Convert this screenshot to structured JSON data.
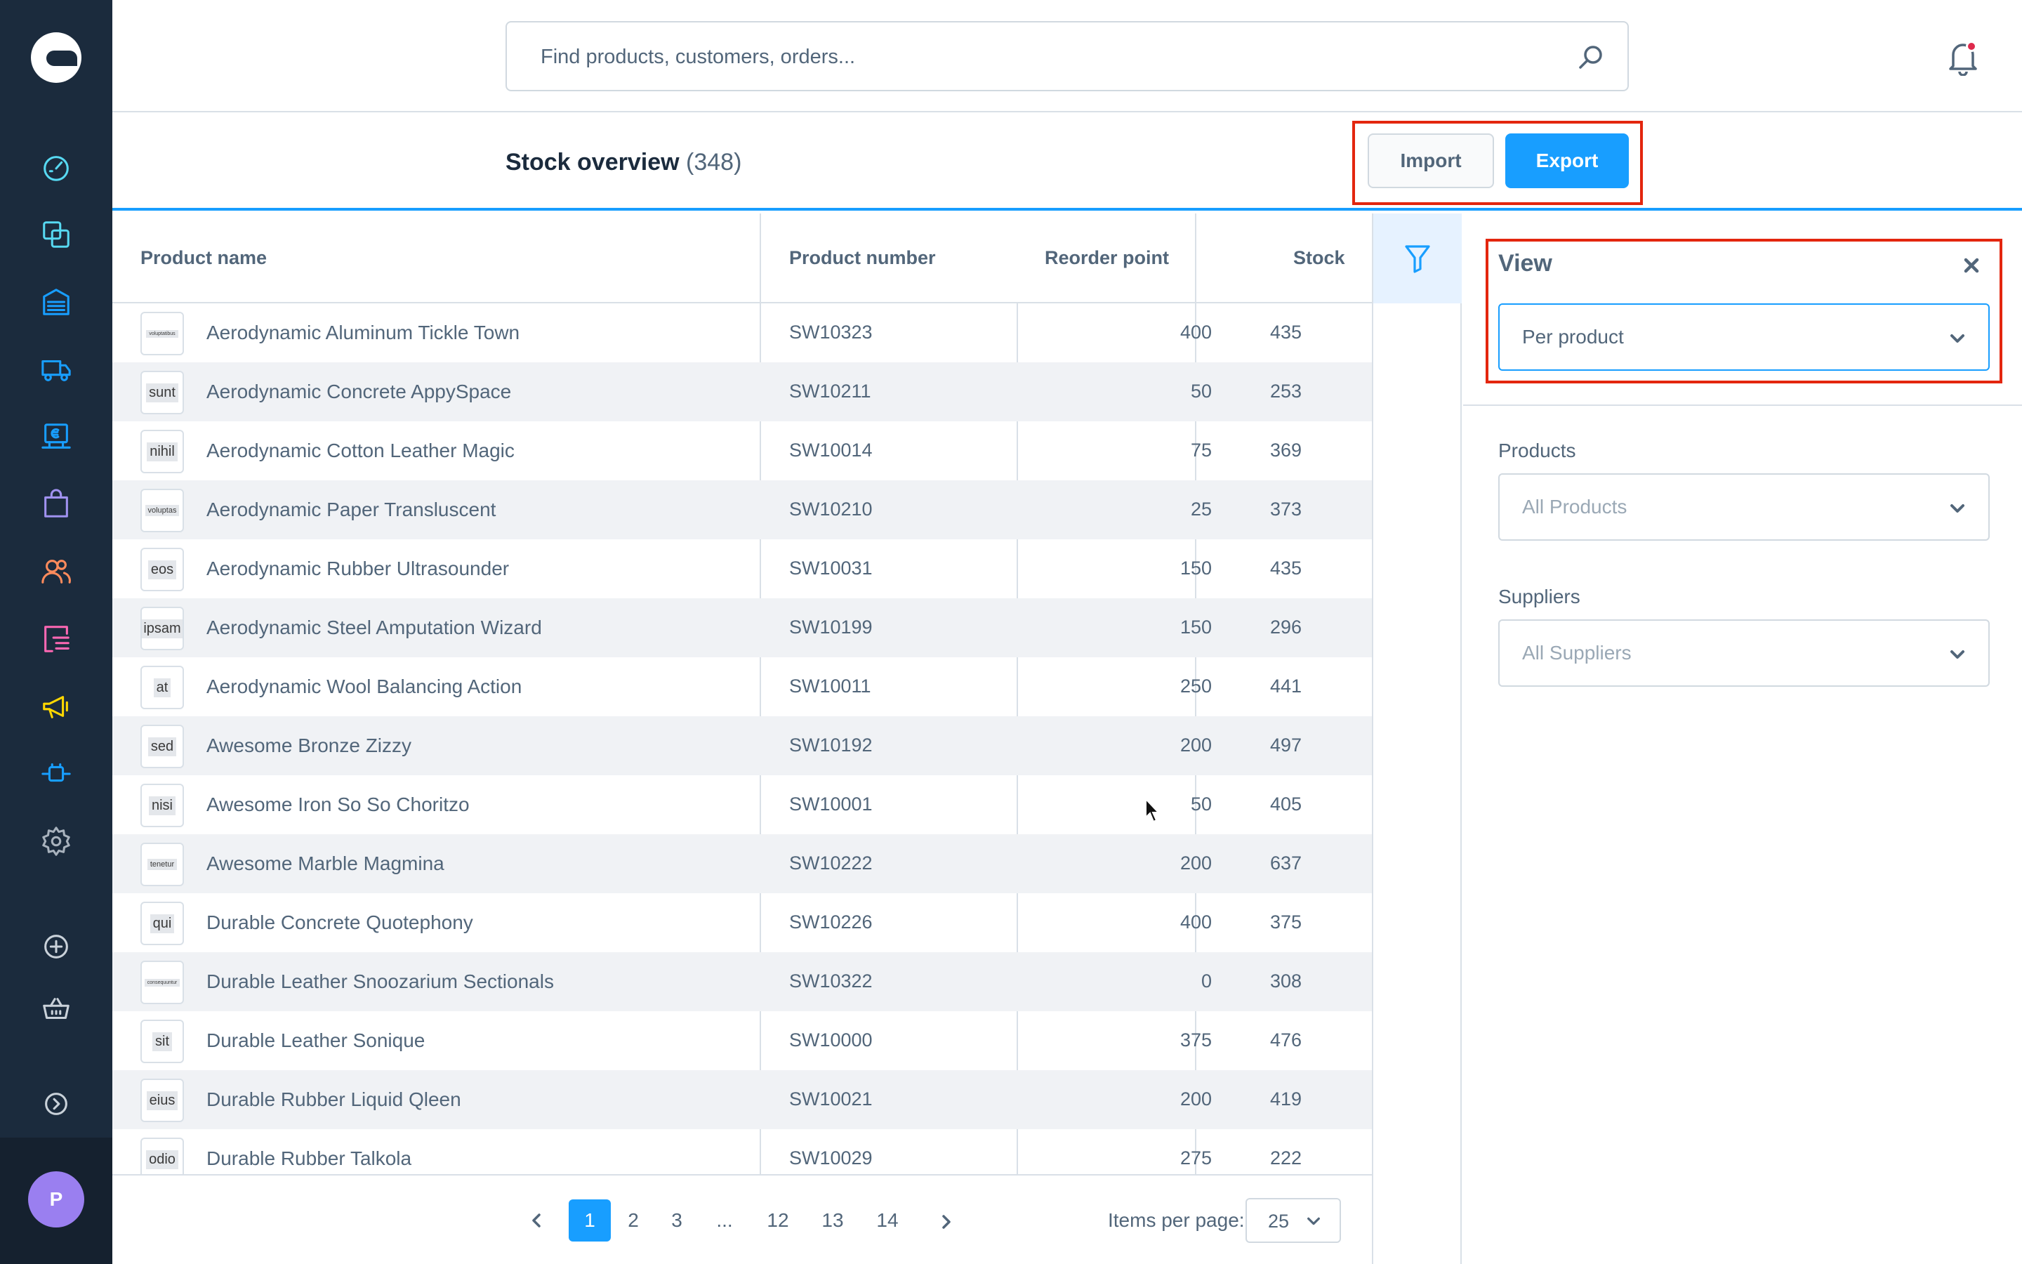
{
  "search": {
    "placeholder": "Find products, customers, orders..."
  },
  "avatar": {
    "initial": "P"
  },
  "header": {
    "title": "Stock overview",
    "count": "(348)",
    "import_label": "Import",
    "export_label": "Export"
  },
  "grid": {
    "columns": [
      "Product name",
      "Product number",
      "Reorder point",
      "Stock"
    ],
    "rows": [
      {
        "thumb": "voluptatibus",
        "name": "Aerodynamic Aluminum Tickle Town",
        "number": "SW10323",
        "reorder": "400",
        "stock": "435"
      },
      {
        "thumb": "sunt",
        "name": "Aerodynamic Concrete AppySpace",
        "number": "SW10211",
        "reorder": "50",
        "stock": "253"
      },
      {
        "thumb": "nihil",
        "name": "Aerodynamic Cotton Leather Magic",
        "number": "SW10014",
        "reorder": "75",
        "stock": "369"
      },
      {
        "thumb": "voluptas",
        "name": "Aerodynamic Paper Transluscent",
        "number": "SW10210",
        "reorder": "25",
        "stock": "373"
      },
      {
        "thumb": "eos",
        "name": "Aerodynamic Rubber Ultrasounder",
        "number": "SW10031",
        "reorder": "150",
        "stock": "435"
      },
      {
        "thumb": "ipsam",
        "name": "Aerodynamic Steel Amputation Wizard",
        "number": "SW10199",
        "reorder": "150",
        "stock": "296"
      },
      {
        "thumb": "at",
        "name": "Aerodynamic Wool Balancing Action",
        "number": "SW10011",
        "reorder": "250",
        "stock": "441"
      },
      {
        "thumb": "sed",
        "name": "Awesome Bronze Zizzy",
        "number": "SW10192",
        "reorder": "200",
        "stock": "497"
      },
      {
        "thumb": "nisi",
        "name": "Awesome Iron So So Choritzo",
        "number": "SW10001",
        "reorder": "50",
        "stock": "405"
      },
      {
        "thumb": "tenetur",
        "name": "Awesome Marble Magmina",
        "number": "SW10222",
        "reorder": "200",
        "stock": "637"
      },
      {
        "thumb": "qui",
        "name": "Durable Concrete Quotephony",
        "number": "SW10226",
        "reorder": "400",
        "stock": "375"
      },
      {
        "thumb": "consequuntur",
        "name": "Durable Leather Snoozarium Sectionals",
        "number": "SW10322",
        "reorder": "0",
        "stock": "308"
      },
      {
        "thumb": "sit",
        "name": "Durable Leather Sonique",
        "number": "SW10000",
        "reorder": "375",
        "stock": "476"
      },
      {
        "thumb": "eius",
        "name": "Durable Rubber Liquid Qleen",
        "number": "SW10021",
        "reorder": "200",
        "stock": "419"
      },
      {
        "thumb": "odio",
        "name": "Durable Rubber Talkola",
        "number": "SW10029",
        "reorder": "275",
        "stock": "222"
      }
    ]
  },
  "pagination": {
    "pages": [
      "1",
      "2",
      "3",
      "...",
      "12",
      "13",
      "14"
    ],
    "active_page": "1",
    "items_per_page_label": "Items per page:",
    "items_per_page": "25"
  },
  "panel": {
    "title": "View",
    "view_value": "Per product",
    "products_label": "Products",
    "products_value": "All Products",
    "suppliers_label": "Suppliers",
    "suppliers_value": "All Suppliers"
  },
  "colors": {
    "accent": "#189eff",
    "sidebar": "#1b2b3d",
    "highlight": "#e3260e",
    "alt_row": "#f0f2f5"
  },
  "sidebar_icons": [
    "dashboard-icon",
    "catalogue-icon",
    "warehouse-icon",
    "shipping-icon",
    "pos-icon",
    "orders-icon",
    "customers-icon",
    "content-icon",
    "marketing-icon",
    "extensions-icon",
    "settings-icon",
    "add-icon",
    "basket-icon",
    "collapse-icon"
  ]
}
